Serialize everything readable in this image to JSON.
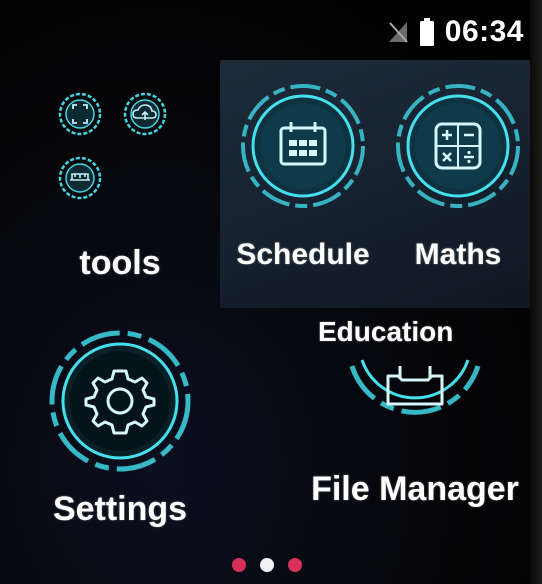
{
  "status_bar": {
    "time": "06:34",
    "signal_icon": "no-sim-icon",
    "battery_icon": "battery-icon"
  },
  "tools_folder": {
    "label": "tools",
    "mini_icons": [
      "scan-icon",
      "cloud-upload-icon",
      "scale-icon"
    ]
  },
  "education_folder": {
    "label": "Education",
    "apps": [
      {
        "label": "Schedule",
        "icon": "calendar-icon"
      },
      {
        "label": "Maths",
        "icon": "calculator-icon"
      }
    ]
  },
  "apps": {
    "settings": {
      "label": "Settings",
      "icon": "gear-icon"
    },
    "file_manager": {
      "label": "File Manager",
      "icon": "folder-icon"
    }
  },
  "pager": {
    "pages": 3,
    "active_index": 1,
    "active_color": "#f2f2f2",
    "inactive_color": "#d8305b"
  },
  "accent_color": "#3fd7e6"
}
